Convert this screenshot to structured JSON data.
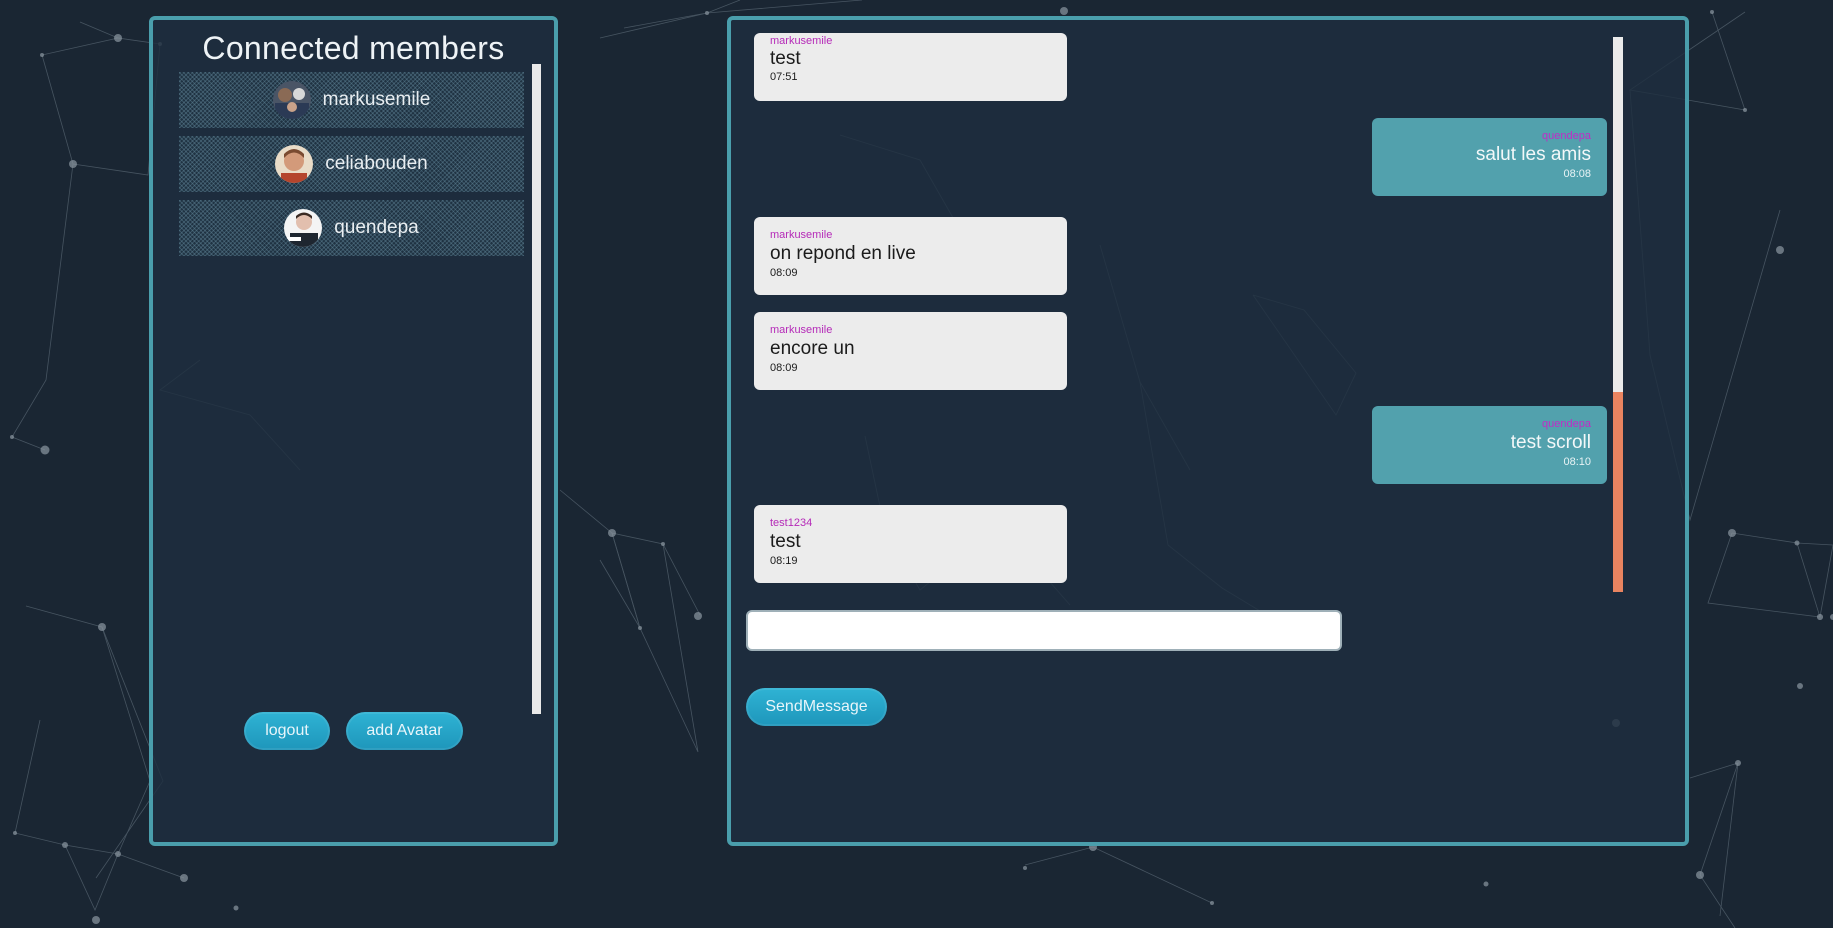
{
  "members_panel": {
    "title": "Connected members",
    "members": [
      {
        "name": "markusemile"
      },
      {
        "name": "celiabouden"
      },
      {
        "name": "quendepa"
      }
    ],
    "logout_label": "logout",
    "add_avatar_label": "add Avatar"
  },
  "chat": {
    "messages": [
      {
        "user": "markusemile",
        "text": "test",
        "time": "07:51",
        "side": "left"
      },
      {
        "user": "quendepa",
        "text": "salut les amis",
        "time": "08:08",
        "side": "right"
      },
      {
        "user": "markusemile",
        "text": "on repond en live",
        "time": "08:09",
        "side": "left"
      },
      {
        "user": "markusemile",
        "text": "encore un",
        "time": "08:09",
        "side": "left"
      },
      {
        "user": "quendepa",
        "text": "test scroll",
        "time": "08:10",
        "side": "right"
      },
      {
        "user": "test1234",
        "text": "test",
        "time": "08:19",
        "side": "left"
      }
    ],
    "input": {
      "value": "",
      "placeholder": ""
    },
    "send_label": "SendMessage"
  },
  "colors": {
    "background": "#1a2633",
    "panel_border": "#4a9eac",
    "button": "#27a6c8",
    "own_message": "#52a1ad",
    "other_message": "#ececec",
    "username": "#b52ab8",
    "scroll_thumb": "#e98460"
  }
}
